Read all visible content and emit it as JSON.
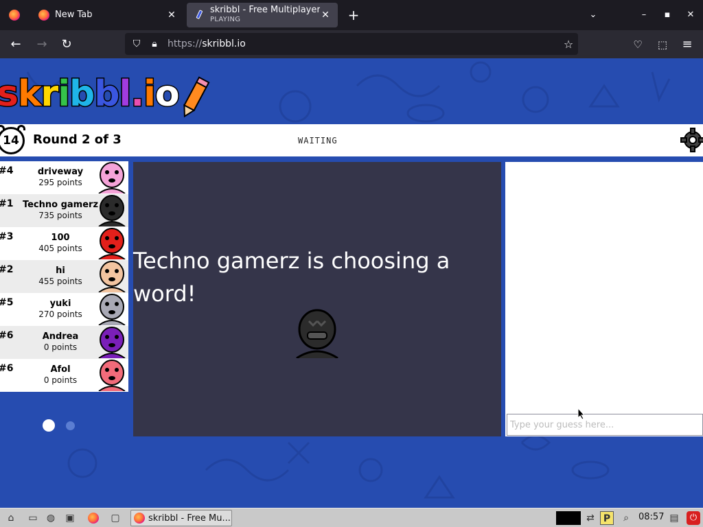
{
  "browser": {
    "tabs": [
      {
        "title": "New Tab",
        "active": false
      },
      {
        "title": "skribbl - Free Multiplayer",
        "subtitle": "PLAYING",
        "active": true
      }
    ],
    "url_scheme": "https://",
    "url_host": "skribbl.io"
  },
  "game": {
    "logo": "skribbl.io",
    "timer": "14",
    "round_label": "Round 2 of 3",
    "status": "WAITING",
    "message": "Techno gamerz is choosing a word!",
    "guess_placeholder": "Type your guess here...",
    "players": [
      {
        "rank": "#4",
        "name": "driveway",
        "points": "295 points",
        "color": "#f5a3d8"
      },
      {
        "rank": "#1",
        "name": "Techno gamerz",
        "points": "735 points",
        "color": "#2b2b2b"
      },
      {
        "rank": "#3",
        "name": "100",
        "points": "405 points",
        "color": "#e3201b"
      },
      {
        "rank": "#2",
        "name": "hi",
        "points": "455 points",
        "color": "#f2c4a0"
      },
      {
        "rank": "#5",
        "name": "yuki",
        "points": "270 points",
        "color": "#a9a9b5"
      },
      {
        "rank": "#6",
        "name": "Andrea",
        "points": "0 points",
        "color": "#7a1fb8"
      },
      {
        "rank": "#6",
        "name": "Afol",
        "points": "0 points",
        "color": "#f26b7a"
      }
    ]
  },
  "taskbar": {
    "task_label": "skribbl - Free Mu...",
    "time": "08:57"
  },
  "colors": {
    "page_bg": "#264cb0",
    "canvas_bg": "#35354a",
    "logo_letters": [
      "#e3201b",
      "#ff7a00",
      "#ffd600",
      "#35c34a",
      "#1fb5e8",
      "#3a56e0",
      "#a13ce0",
      "#e84fb0",
      "#ff7a00",
      "#ffffff"
    ]
  }
}
